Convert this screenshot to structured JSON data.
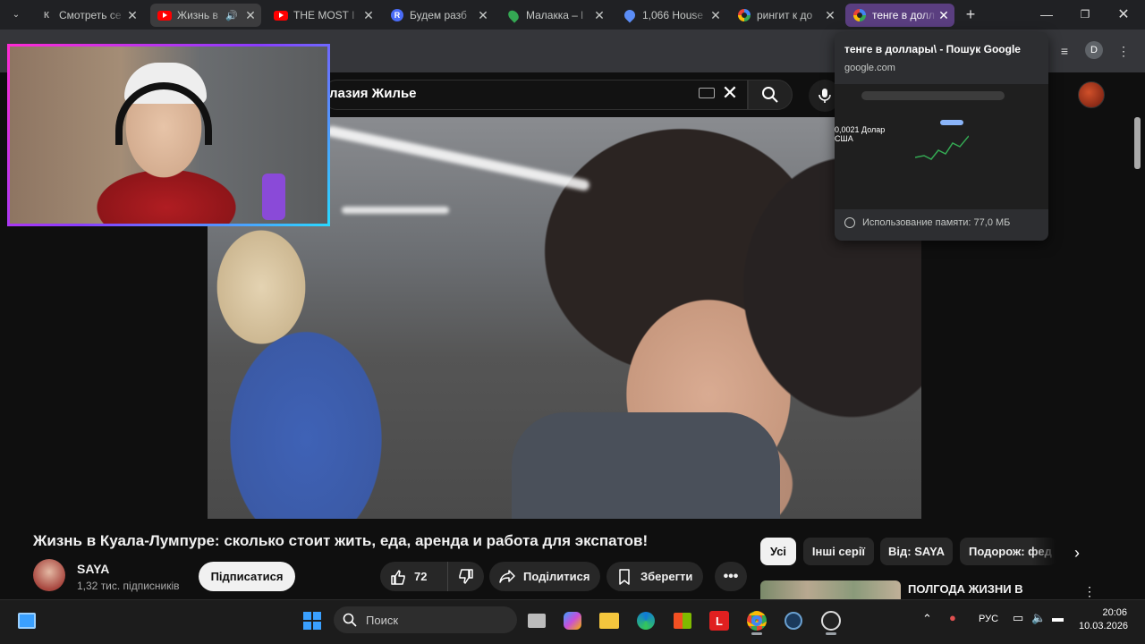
{
  "browser": {
    "tabs": [
      {
        "title": "Смотреть се",
        "favicon": "kinopoisk-icon"
      },
      {
        "title": "Жизнь в",
        "favicon": "youtube-icon",
        "audio": true
      },
      {
        "title": "THE MOST I",
        "favicon": "youtube-icon"
      },
      {
        "title": "Будем разб",
        "favicon": "r-icon"
      },
      {
        "title": "Малакка – l",
        "favicon": "maps-icon"
      },
      {
        "title": "1,066 House",
        "favicon": "pin-icon"
      },
      {
        "title": "рингит к до",
        "favicon": "google-icon"
      },
      {
        "title": "тенге в долл",
        "favicon": "google-icon"
      }
    ],
    "new_tab_label": "+",
    "profile_initial": "D"
  },
  "hovercard": {
    "title": "тенге в доллары\\ - Пошук Google",
    "domain": "google.com",
    "preview_value": "0,0021 Долар США",
    "memory": "Использование памяти: 77,0 МБ"
  },
  "youtube": {
    "search_query": "лазия  Жилье",
    "video_title": "Жизнь в Куала-Лумпуре: сколько стоит жить, еда, аренда и работа для экспатов!",
    "channel_name": "SAYA",
    "subscribers": "1,32 тис. підписників",
    "subscribe_label": "Підписатися",
    "likes": "72",
    "share_label": "Поділитися",
    "save_label": "Зберегти",
    "chips": [
      "Усі",
      "Інші серії",
      "Від: SAYA",
      "Подорож: фед"
    ],
    "recommendation_title": "ПОЛГОДА ЖИЗНИ В"
  },
  "taskbar": {
    "search_placeholder": "Поиск",
    "language": "РУС",
    "time": "20:06",
    "date": "10.03.2026"
  }
}
